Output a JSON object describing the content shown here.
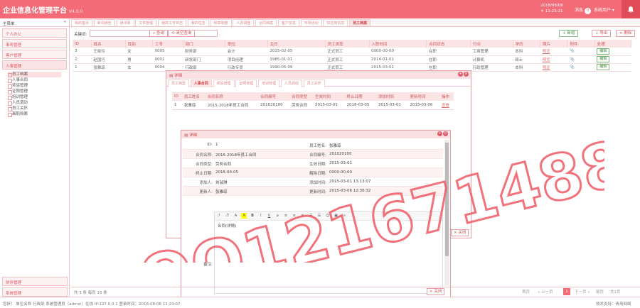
{
  "header": {
    "title": "企业信息化管理平台",
    "version": "V4.0.0",
    "date": "2018/08/08",
    "time": "☀ 11:23:21",
    "notice_label": "消息",
    "notice_count": "0",
    "user_label": "系统用户 ▾"
  },
  "sidebar": {
    "title": "主菜单",
    "collapse": "«",
    "menus": [
      "个人办公",
      "事务管理",
      "客户管理",
      "人事管理"
    ],
    "hr_items": [
      "员工档案",
      "人事合同",
      "奖惩管理",
      "证照管理",
      "培训管理",
      "人员调动",
      "员工关怀"
    ],
    "hr_extra": "离职档案",
    "bottom_menus": [
      "财务管理",
      "系统管理"
    ]
  },
  "tabs": [
    "我的首页",
    "新闻通告",
    "通讯录",
    "文件管理",
    "我的工作日志",
    "我的任务",
    "规章制度",
    "人员调整",
    "合同档案",
    "客户信息",
    "市场活动",
    "供应商信息",
    "员工档案"
  ],
  "toolbar": {
    "keyword_label": "关键词:",
    "search": "查询",
    "reset": "清空查询",
    "add": "+ 新增",
    "export": "↓ 导出",
    "delete": "× 删除"
  },
  "grid": {
    "columns": [
      "ID",
      "姓名",
      "性别",
      "工号",
      "部门",
      "职位",
      "生日",
      "员工类型",
      "入职时间",
      "合同状态",
      "行业",
      "学历",
      "照片",
      "附件",
      "处理"
    ],
    "rows": [
      [
        "3",
        "王晓玲",
        "女",
        "0005",
        "财务部",
        "会计",
        "2015-02-05",
        "正式员工",
        "0000-00-00",
        "在职",
        "工商管理",
        "本科",
        "预览",
        "",
        "编辑"
      ],
      [
        "2",
        "赵国巧",
        "男",
        "0001",
        "研发部门",
        "项目经理",
        "1985-01-01",
        "正式员工",
        "2014-01-01",
        "在职",
        "计算机",
        "硕士",
        "预览",
        "",
        "编辑"
      ],
      [
        "1",
        "张雅琼",
        "女",
        "0004",
        "行政部",
        "行政专员",
        "1990-05-09",
        "正式员工",
        "2015-03-01",
        "在职",
        "行政管理",
        "本科",
        "预览",
        "",
        "编辑"
      ]
    ]
  },
  "win1": {
    "title": "详细",
    "tabs": [
      "员工档案",
      "人事合同",
      "奖惩管理",
      "证照管理",
      "培训管理",
      "人员调动",
      "员工关怀"
    ],
    "columns": [
      "ID",
      "员工姓名",
      "合同名称",
      "合同编号",
      "合同类型",
      "生效时间",
      "终止日期",
      "添加时间",
      "更新时间",
      "操作"
    ],
    "row": [
      "1",
      "张雅琼",
      "2015-2018年员工合同",
      "201020100",
      "劳务合同",
      "2015-03-01",
      "2018-03-05",
      "2015-03-01",
      "2015-03-06",
      "查看"
    ],
    "close": "关闭"
  },
  "win2": {
    "title": "详细",
    "fields": {
      "id_l": "ID:",
      "id_v": "1",
      "emp_l": "员工姓名:",
      "emp_v": "张雅琼",
      "cname_l": "合同名称:",
      "cname_v": "2015-2018年员工合同",
      "cno_l": "合同编号:",
      "cno_v": "201020100",
      "ctype_l": "合同类型:",
      "ctype_v": "劳务合同",
      "eff_l": "生效日期:",
      "eff_v": "2015-03-01",
      "end_l": "终止日期:",
      "end_v": "2015-03-05",
      "rel_l": "解除日期:",
      "rel_v": "0000-00-00",
      "adder_l": "添加人:",
      "adder_v": "刘淑琪",
      "addt_l": "添加时间:",
      "addt_v": "2015-03-01 13:13:07",
      "upd_l": "更新人:",
      "upd_v": "张雅琼",
      "updt_l": "更新时间:",
      "updt_v": "2015-03-06 12:36:32"
    },
    "editor_tools": [
      "ℱ",
      "ₜT",
      "A",
      "A",
      "B",
      "I",
      "U",
      "⌀",
      "≡",
      "≡",
      "≡",
      "☰",
      "☰",
      "☺",
      "▣",
      "∞"
    ],
    "content": "合同(详情)",
    "remark_label": "备注:",
    "close": "关闭"
  },
  "pager": {
    "info": "共 3 条 每页 15 条",
    "first": "首页",
    "prev": "« 上一页",
    "current": "1",
    "next": "下一页 »",
    "last": "尾页",
    "total": "共1页"
  },
  "status": {
    "left": "您好！ 单位名称 行政部 系统管理员（admin）在线 IP:127.0.0.1 登录时间：2018-08-08 11:23:07",
    "right": "技术支持：青岛网络"
  },
  "watermark": "QQ1216714885"
}
